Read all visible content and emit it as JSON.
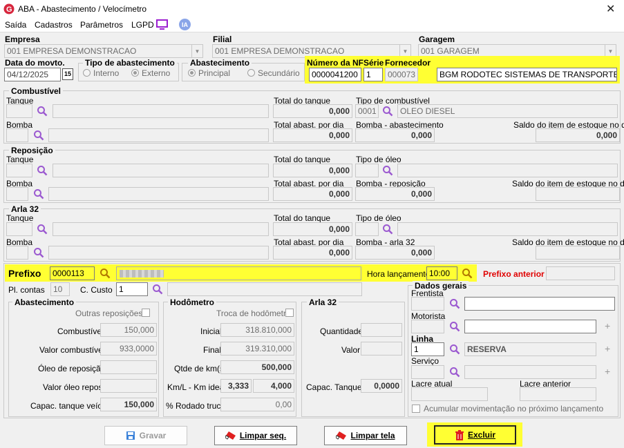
{
  "window": {
    "title": "ABA - Abastecimento / Velocímetro",
    "close": "✕"
  },
  "menu": [
    "Saída",
    "Cadastros",
    "Parâmetros",
    "LGPD"
  ],
  "ia_badge": "IA",
  "header": {
    "empresa_label": "Empresa",
    "empresa_value": "001 EMPRESA DEMONSTRACAO",
    "filial_label": "Filial",
    "filial_value": "001 EMPRESA DEMONSTRACAO",
    "garagem_label": "Garagem",
    "garagem_value": "001 GARAGEM",
    "data_label": "Data do movto.",
    "data_value": "04/12/2025",
    "cal_label": "15",
    "tipo_label": "Tipo de abastecimento",
    "tipo_interno": "Interno",
    "tipo_externo": "Externo",
    "abast_label": "Abastecimento",
    "abast_principal": "Principal",
    "abast_secundario": "Secundário",
    "nf_label": "Número da NF",
    "nf_value": "0000041200",
    "serie_label": "Série",
    "serie_value": "1",
    "fornecedor_label": "Fornecedor",
    "fornecedor_code": "000073",
    "fornecedor_name": "BGM RODOTEC SISTEMAS DE TRANSPORTE"
  },
  "combustivel": {
    "title": "Combustível",
    "tanque": "Tanque",
    "bomba": "Bomba",
    "total_tanque_label": "Total do tanque",
    "total_tanque": "0,000",
    "tipo_label": "Tipo de combustível",
    "tipo_code": "0001",
    "tipo_name": "OLEO DIESEL",
    "total_dia_label": "Total abast. por dia",
    "total_dia": "0,000",
    "bomba_abast_label": "Bomba - abastecimento",
    "bomba_abast": "0,000",
    "saldo_label": "Saldo do item de estoque no dia",
    "saldo": "0,000"
  },
  "reposicao": {
    "title": "Reposição",
    "tanque": "Tanque",
    "bomba": "Bomba",
    "total_tanque_label": "Total do tanque",
    "total_tanque": "0,000",
    "tipo_label": "Tipo de óleo",
    "total_dia_label": "Total abast. por dia",
    "total_dia": "0,000",
    "bomba_label": "Bomba - reposição",
    "bomba_val": "0,000",
    "saldo_label": "Saldo do item de estoque no dia"
  },
  "arla": {
    "title": "Arla 32",
    "tanque": "Tanque",
    "bomba": "Bomba",
    "total_tanque_label": "Total do tanque",
    "total_tanque": "0,000",
    "tipo_label": "Tipo de óleo",
    "total_dia_label": "Total abast. por dia",
    "total_dia": "0,000",
    "bomba_label": "Bomba - arla 32",
    "bomba_val": "0,000",
    "saldo_label": "Saldo do item de estoque no dia"
  },
  "prefixo": {
    "label": "Prefixo",
    "value": "0000113",
    "hora_label": "Hora lançamento",
    "hora_value": "10:00",
    "anterior_label": "Prefixo anterior",
    "pl_label": "Pl. contas",
    "pl_value": "10",
    "custo_label": "C. Custo",
    "custo_value": "1"
  },
  "abastecimento": {
    "title": "Abastecimento",
    "outras": "Outras reposições",
    "combustivel_label": "Combustível",
    "combustivel": "150,000",
    "valor_comb_label": "Valor combustível",
    "valor_comb": "933,0000",
    "oleo_label": "Óleo de reposição",
    "valor_oleo_label": "Valor óleo repos.",
    "capac_label": "Capac. tanque veíc.",
    "capac": "150,000"
  },
  "hodometro": {
    "title": "Hodômetro",
    "troca": "Troca de hodômetro",
    "inicial_label": "Inicial",
    "inicial": "318.810,000",
    "final_label": "Final",
    "final": "319.310,000",
    "qtde_label": "Qtde de km(s)",
    "qtde": "500,000",
    "kml_label": "Km/L - Km ideal",
    "kml": "3,333",
    "ideal": "4,000",
    "rodado_label": "% Rodado truck",
    "rodado": "0,00"
  },
  "arla32": {
    "title": "Arla 32",
    "qtd_label": "Quantidade",
    "valor_label": "Valor",
    "capac_label": "Capac. Tanque",
    "capac": "0,0000"
  },
  "dados": {
    "title": "Dados gerais",
    "frentista": "Frentista",
    "motorista": "Motorista",
    "linha_label": "Linha",
    "linha_value": "1",
    "linha_name": "RESERVA",
    "servico": "Serviço",
    "lacre_atual": "Lacre atual",
    "lacre_anterior": "Lacre anterior",
    "acumular": "Acumular movimentação no próximo lançamento"
  },
  "buttons": {
    "gravar": "Gravar",
    "limpar_seq": "Limpar seq.",
    "limpar_tela": "Limpar tela",
    "excluir": "Excluir"
  },
  "colors": {
    "highlight": "#ffff33",
    "accent": "#ff0000",
    "search": "#9b59d0"
  }
}
